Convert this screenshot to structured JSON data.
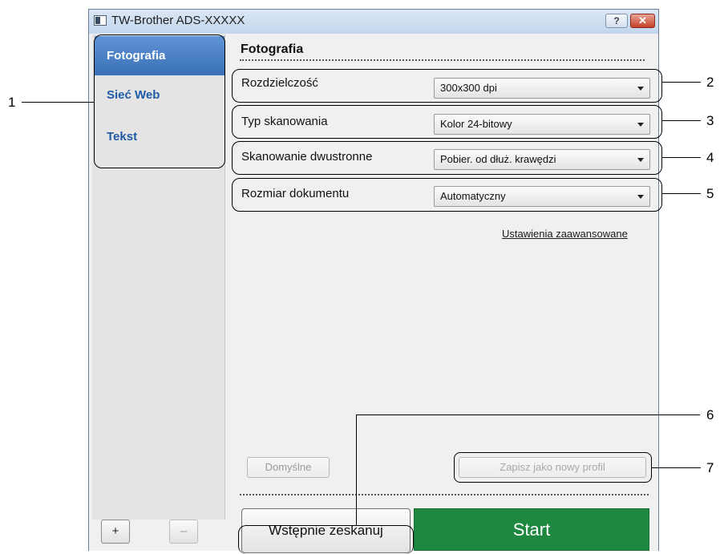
{
  "window": {
    "title": "TW-Brother ADS-XXXXX",
    "help_label": "?",
    "close_label": "✕"
  },
  "sidebar": {
    "items": [
      {
        "label": "Fotografia",
        "selected": true
      },
      {
        "label": "Sieć Web",
        "selected": false
      },
      {
        "label": "Tekst",
        "selected": false
      }
    ],
    "add_label": "+",
    "remove_label": "–"
  },
  "panel": {
    "title": "Fotografia",
    "rows": [
      {
        "label": "Rozdzielczość",
        "value": "300x300 dpi"
      },
      {
        "label": "Typ skanowania",
        "value": "Kolor 24-bitowy"
      },
      {
        "label": "Skanowanie dwustronne",
        "value": "Pobier. od dłuż. krawędzi"
      },
      {
        "label": "Rozmiar dokumentu",
        "value": "Automatyczny"
      }
    ],
    "advanced_link": "Ustawienia zaawansowane",
    "defaults_label": "Domyślne",
    "save_profile_label": "Zapisz jako nowy profil",
    "prescan_label": "Wstępnie zeskanuj",
    "start_label": "Start"
  },
  "callouts": [
    "1",
    "2",
    "3",
    "4",
    "5",
    "6",
    "7"
  ],
  "colors": {
    "start_green": "#1e8740",
    "selected_blue": "#3a70b5",
    "nav_text": "#1f5aa6"
  }
}
